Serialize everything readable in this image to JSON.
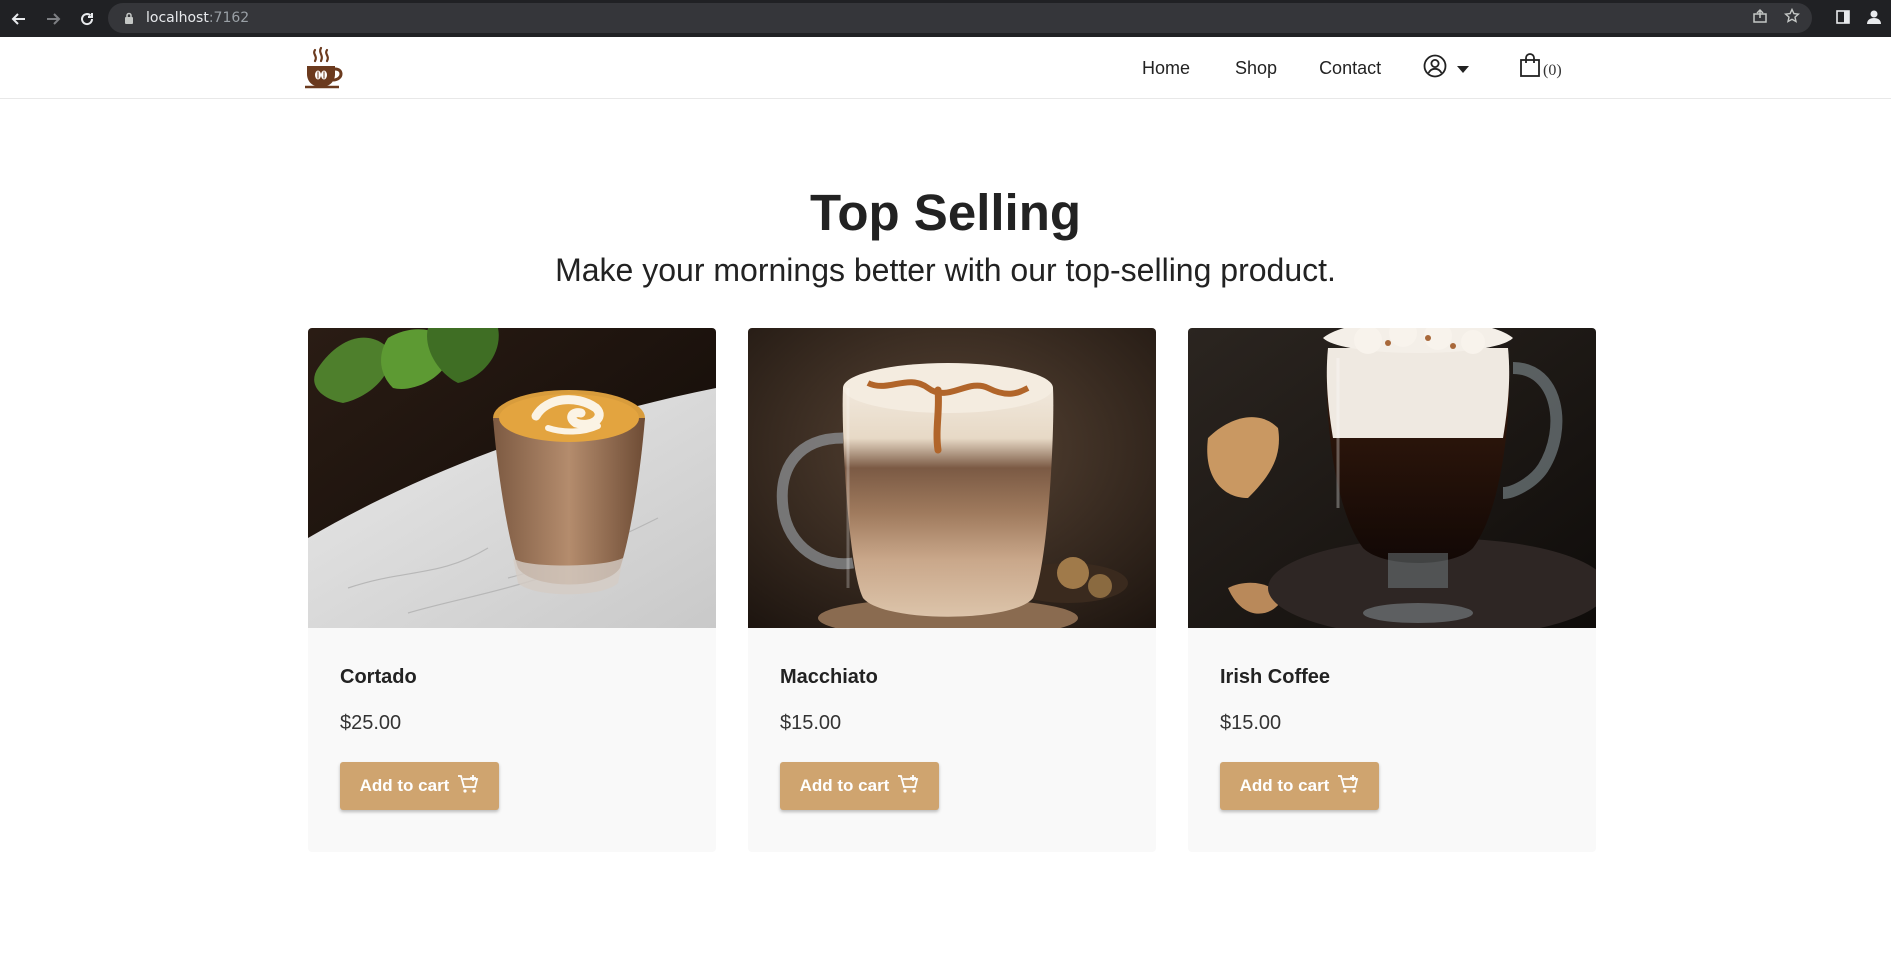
{
  "browser": {
    "url_host": "localhost",
    "url_port": ":7162"
  },
  "header": {
    "nav": [
      "Home",
      "Shop",
      "Contact"
    ],
    "cart_count": "(0)"
  },
  "section": {
    "title": "Top Selling",
    "subtitle": "Make your mornings better with our top-selling product."
  },
  "products": [
    {
      "name": "Cortado",
      "price": "$25.00",
      "button": "Add to cart"
    },
    {
      "name": "Macchiato",
      "price": "$15.00",
      "button": "Add to cart"
    },
    {
      "name": "Irish Coffee",
      "price": "$15.00",
      "button": "Add to cart"
    }
  ],
  "colors": {
    "accent": "#cfa46f",
    "card_bg": "#f9f9f9",
    "chrome_bg": "#202124"
  }
}
